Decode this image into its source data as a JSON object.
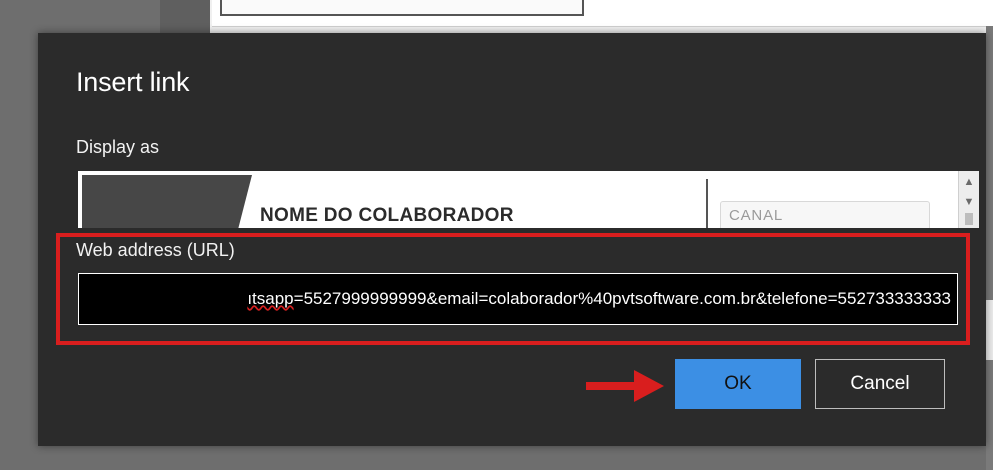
{
  "dialog": {
    "title": "Insert link",
    "display_label": "Display as",
    "display_preview": {
      "name_text": "NOME DO COLABORADOR",
      "field_text": "CANAL"
    },
    "url_label": "Web address (URL)",
    "url_value_prefix": "ıtsapp",
    "url_value_rest": "=5527999999999&email=colaborador%40pvtsoftware.com.br&telefone=552733333333",
    "ok_label": "OK",
    "cancel_label": "Cancel"
  },
  "colors": {
    "dialog_bg": "#2b2b2b",
    "ok_button": "#3c8fe4",
    "annotation_red": "#d91e1e"
  },
  "icons": {
    "scroll_up": "▲",
    "scroll_down": "▼"
  }
}
